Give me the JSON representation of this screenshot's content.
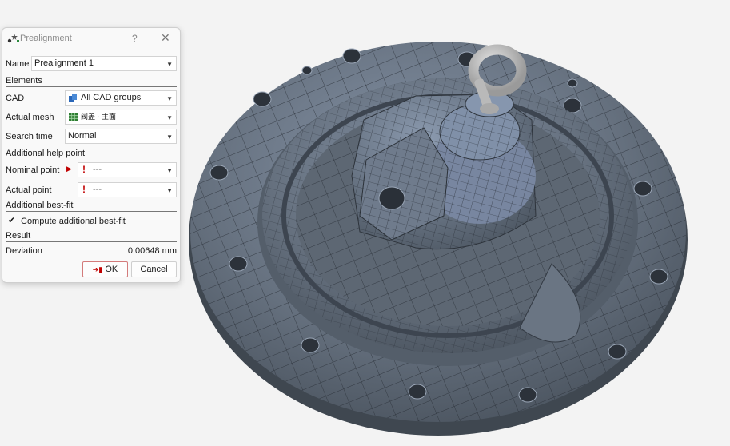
{
  "dialog": {
    "title": "Prealignment",
    "help_glyph": "?",
    "close_glyph": "✕",
    "name_label": "Name",
    "name_value": "Prealignment 1",
    "elements_heading": "Elements",
    "cad_label": "CAD",
    "cad_value": "All CAD groups",
    "actual_mesh_label": "Actual mesh",
    "actual_mesh_value": "阀盖 - 主面",
    "search_time_label": "Search time",
    "search_time_value": "Normal",
    "additional_help_heading": "Additional help point",
    "nominal_point_label": "Nominal point",
    "nominal_point_value": "---",
    "actual_point_label": "Actual point",
    "actual_point_value": "---",
    "additional_bestfit_heading": "Additional best-fit",
    "compute_bestfit_label": "Compute additional best-fit",
    "compute_bestfit_checked": true,
    "result_heading": "Result",
    "deviation_label": "Deviation",
    "deviation_value": "0.00648 mm",
    "ok_label": "OK",
    "cancel_label": "Cancel"
  },
  "icons": {
    "app": "prealignment-icon",
    "cad": "cad-groups-icon",
    "mesh": "mesh-icon",
    "warning": "exclamation-icon",
    "pick": "pick-arrow-icon",
    "ok": "ok-icon"
  },
  "colors": {
    "part_gray": "#5f6873",
    "mesh_lines": "#2a2f37",
    "highlight_blue": "#8a9bb2",
    "warning_red": "#c00000",
    "ok_border": "#d37b7b",
    "background": "#f3f3f3"
  }
}
